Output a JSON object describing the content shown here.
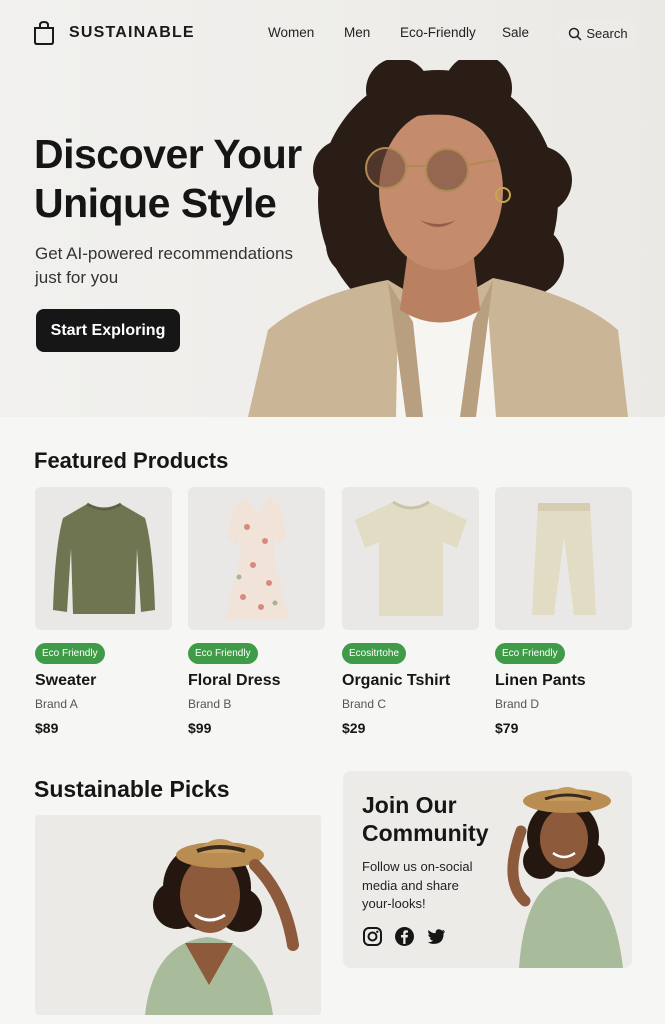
{
  "brand": {
    "name": "SUSTAINABLE"
  },
  "nav": {
    "women": "Women",
    "men": "Men",
    "eco": "Eco-Friendly",
    "sale": "Sale",
    "search": "Search"
  },
  "hero": {
    "title": "Discover Your Unique Style",
    "subtitle": "Get AI-powered recommendations just for you",
    "cta": "Start Exploring"
  },
  "featured": {
    "title": "Featured Products",
    "products": [
      {
        "badge": "Eco Friendly",
        "name": "Sweater",
        "brand": "Brand A",
        "price": "$89",
        "icon": "sweater-icon"
      },
      {
        "badge": "Eco Friendly",
        "name": "Floral Dress",
        "brand": "Brand B",
        "price": "$99",
        "icon": "dress-icon"
      },
      {
        "badge": "Ecositrtohe",
        "name": "Organic Tshirt",
        "brand": "Brand C",
        "price": "$29",
        "icon": "tshirt-icon"
      },
      {
        "badge": "Eco Friendly",
        "name": "Linen Pants",
        "brand": "Brand D",
        "price": "$79",
        "icon": "pants-icon"
      }
    ]
  },
  "picks": {
    "title": "Sustainable Picks"
  },
  "community": {
    "title": "Join Our Community",
    "text": "Follow us on-social media and share your-looks!",
    "socials": [
      "instagram-icon",
      "facebook-icon",
      "twitter-icon"
    ]
  },
  "colors": {
    "badge": "#3f9b48",
    "cta": "#161616",
    "background": "#f6f6f4"
  }
}
